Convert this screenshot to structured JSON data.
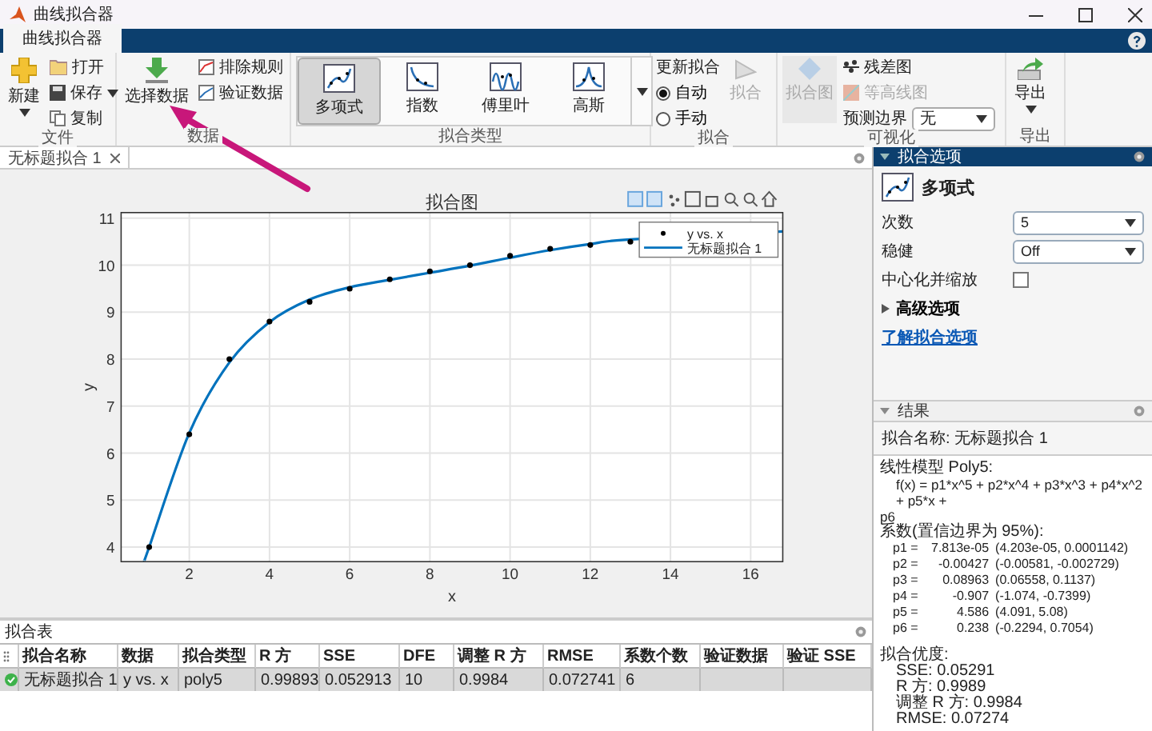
{
  "window": {
    "title": "曲线拟合器"
  },
  "ribbon_tabs": [
    {
      "label": "曲线拟合器",
      "selected": true
    }
  ],
  "toolstrip": {
    "file": {
      "title": "文件",
      "new": {
        "label": "新建"
      },
      "open": {
        "label": "打开"
      },
      "save": {
        "label": "保存"
      },
      "copy": {
        "label": "复制"
      }
    },
    "data": {
      "title": "数据",
      "select": {
        "label": "选择数据"
      },
      "exclude": {
        "label": "排除规则"
      },
      "validate": {
        "label": "验证数据"
      }
    },
    "fit_type": {
      "title": "拟合类型",
      "items": [
        {
          "kind": "polynomial",
          "label": "多项式",
          "selected": true
        },
        {
          "kind": "exponential",
          "label": "指数",
          "selected": false
        },
        {
          "kind": "fourier",
          "label": "傅里叶",
          "selected": false
        },
        {
          "kind": "gaussian",
          "label": "高斯",
          "selected": false
        }
      ]
    },
    "fit": {
      "title": "拟合",
      "update_label": "更新拟合",
      "modes": [
        {
          "label": "自动",
          "selected": true
        },
        {
          "label": "手动",
          "selected": false
        }
      ],
      "fit_button": {
        "label": "拟合",
        "disabled": true
      }
    },
    "visualize": {
      "title": "可视化",
      "fit_plot": {
        "label": "拟合图",
        "disabled": true
      },
      "residual": {
        "label": "残差图",
        "disabled": false
      },
      "contour": {
        "label": "等高线图",
        "disabled": true
      },
      "bounds": {
        "label": "预测边界",
        "value": "无"
      }
    },
    "export": {
      "title": "导出",
      "button": {
        "label": "导出"
      }
    }
  },
  "doc_tabs": [
    {
      "label": "无标题拟合 1",
      "selected": true
    }
  ],
  "plot": {
    "title": "拟合图",
    "chart_data": {
      "type": "line",
      "xlabel": "x",
      "ylabel": "y",
      "grid": true,
      "legend": "upper right",
      "x": [
        0.88,
        1,
        2,
        3,
        4,
        5,
        6,
        7,
        8,
        9,
        10,
        11,
        12,
        13,
        16.8
      ],
      "series": [
        {
          "name": "无标题拟合 1",
          "color": "#0072bd",
          "values": [
            3.72,
            4.0,
            6.43,
            7.93,
            8.79,
            9.27,
            9.53,
            9.69,
            9.84,
            9.99,
            10.16,
            10.32,
            10.45,
            10.55,
            10.72
          ]
        },
        {
          "name": "y vs. x",
          "type": "scatter",
          "marker": true,
          "color": "#000000",
          "values": [
            null,
            4.0,
            6.4,
            8.0,
            8.8,
            9.22,
            9.5,
            9.7,
            9.87,
            10.0,
            10.2,
            10.35,
            10.43,
            10.5,
            null
          ]
        }
      ],
      "xlim": [
        0.3,
        16.8
      ],
      "ylim": [
        3.69,
        11.12
      ],
      "xticks": [
        2,
        4,
        6,
        8,
        10,
        12,
        14,
        16
      ],
      "yticks": [
        4,
        5,
        6,
        7,
        8,
        9,
        10,
        11
      ]
    }
  },
  "fit_options": {
    "title": "拟合选项",
    "type_label": "多项式",
    "fields": [
      {
        "kind": "dropdown",
        "label": "次数",
        "value": "5"
      },
      {
        "kind": "dropdown",
        "label": "稳健",
        "value": "Off"
      },
      {
        "kind": "checkbox",
        "label": "中心化并缩放",
        "checked": false
      }
    ],
    "advanced": {
      "label": "高级选项",
      "expanded": false
    },
    "link": "了解拟合选项"
  },
  "results": {
    "title": "结果",
    "fit_name": "拟合名称: 无标题拟合 1",
    "model_title": "线性模型 Poly5:",
    "formula": "f(x) = p1*x^5 + p2*x^4 + p3*x^3 + p4*x^2 + p5*x +",
    "formula_tail": "p6",
    "coef_title": "系数(置信边界为 95%):",
    "coefficients": [
      {
        "name": "p1 =",
        "value": "7.813e-05",
        "interval": "(4.203e-05, 0.0001142)"
      },
      {
        "name": "p2 =",
        "value": "-0.00427",
        "interval": "(-0.00581, -0.002729)"
      },
      {
        "name": "p3 =",
        "value": "0.08963",
        "interval": "(0.06558, 0.1137)"
      },
      {
        "name": "p4 =",
        "value": "-0.907",
        "interval": "(-1.074, -0.7399)"
      },
      {
        "name": "p5 =",
        "value": "4.586",
        "interval": "(4.091, 5.08)"
      },
      {
        "name": "p6 =",
        "value": "0.238",
        "interval": "(-0.2294, 0.7054)"
      }
    ],
    "gof_title": "拟合优度:",
    "gof": [
      "SSE: 0.05291",
      "R 方: 0.9989",
      "调整 R 方: 0.9984",
      "RMSE: 0.07274"
    ]
  },
  "fit_table": {
    "title": "拟合表",
    "columns": [
      "拟合名称",
      "数据",
      "拟合类型",
      "R 方",
      "SSE",
      "DFE",
      "调整 R 方",
      "RMSE",
      "系数个数",
      "验证数据",
      "验证 SSE"
    ],
    "rows": [
      {
        "valid": true,
        "selected": true,
        "cells": [
          "无标题拟合 1",
          "y vs. x",
          "poly5",
          "0.99893",
          "0.052913",
          "10",
          "0.9984",
          "0.072741",
          "6"
        ]
      }
    ]
  }
}
